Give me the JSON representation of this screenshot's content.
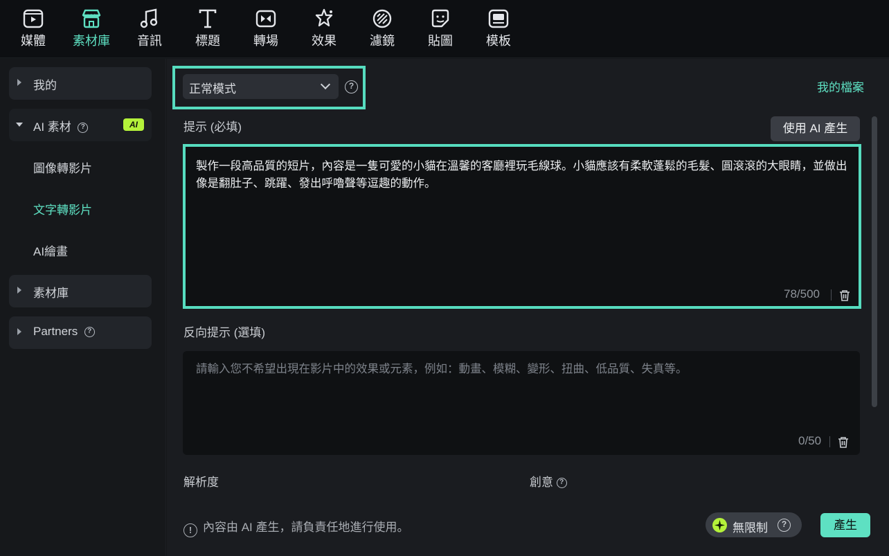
{
  "toolbar": {
    "items": [
      {
        "label": "媒體",
        "icon": "media-icon",
        "active": false
      },
      {
        "label": "素材庫",
        "icon": "store-icon",
        "active": true
      },
      {
        "label": "音訊",
        "icon": "music-icon",
        "active": false
      },
      {
        "label": "標題",
        "icon": "title-icon",
        "active": false
      },
      {
        "label": "轉場",
        "icon": "transition-icon",
        "active": false
      },
      {
        "label": "效果",
        "icon": "effects-icon",
        "active": false
      },
      {
        "label": "濾鏡",
        "icon": "filter-icon",
        "active": false
      },
      {
        "label": "貼圖",
        "icon": "sticker-icon",
        "active": false
      },
      {
        "label": "模板",
        "icon": "template-icon",
        "active": false
      }
    ]
  },
  "sidebar": {
    "my": "我的",
    "ai_assets": "AI 素材",
    "ai_badge": "AI",
    "sub_items": [
      "圖像轉影片",
      "文字轉影片",
      "AI繪畫"
    ],
    "active_sub": "文字轉影片",
    "library": "素材庫",
    "partners": "Partners"
  },
  "main": {
    "mode_value": "正常模式",
    "my_files": "我的檔案",
    "prompt_label": "提示 (必填)",
    "ai_generate_btn": "使用 AI 產生",
    "prompt_text": "製作一段高品質的短片，內容是一隻可愛的小貓在溫馨的客廳裡玩毛線球。小貓應該有柔軟蓬鬆的毛髮、圓滾滾的大眼睛，並做出像是翻肚子、跳躍、發出呼嚕聲等逗趣的動作。",
    "prompt_count": "78/500",
    "negative_label": "反向提示 (選填)",
    "negative_placeholder": "請輸入您不希望出現在影片中的效果或元素，例如：動畫、模糊、變形、扭曲、低品質、失真等。",
    "negative_count": "0/50",
    "resolution_label": "解析度",
    "creativity_label": "創意",
    "footer_note": "內容由 AI 產生，請負責任地進行使用。",
    "unlimited_label": "無限制",
    "generate_btn": "產生"
  },
  "colors": {
    "accent": "#5ee0c2",
    "highlight": "#56dcbf",
    "ai_badge": "#b4f23a"
  }
}
